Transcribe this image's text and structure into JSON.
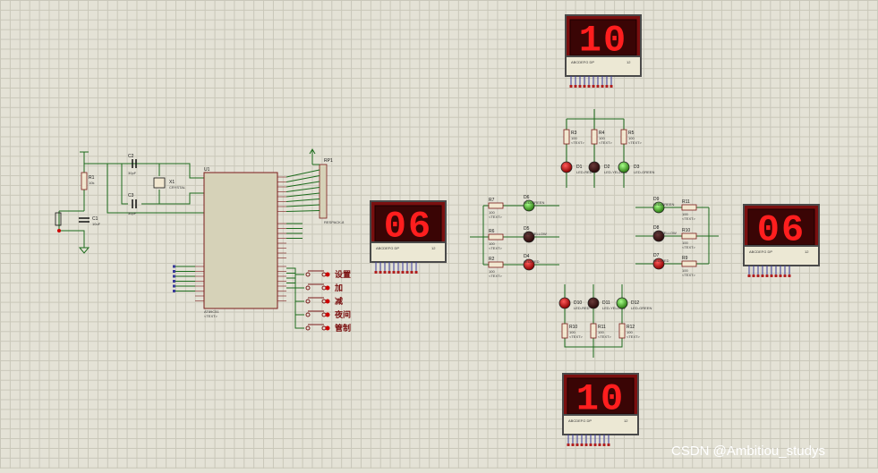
{
  "mcu": {
    "ref": "U1",
    "part": "AT89C51",
    "placeholder": "<TEXT>"
  },
  "crystal": {
    "ref": "X1",
    "part": "CRYSTAL"
  },
  "resistor_pack": {
    "ref": "RP1",
    "part": "RESPACK-8"
  },
  "caps": [
    {
      "ref": "C1",
      "value": "10uF"
    },
    {
      "ref": "C2",
      "value": "30pF"
    },
    {
      "ref": "C3",
      "value": "30pF"
    }
  ],
  "r1": {
    "ref": "R1",
    "value": "10k"
  },
  "displays": {
    "north": {
      "digits": "10",
      "seg_label": "ABCDEFG  DP",
      "pins_label": "12"
    },
    "south": {
      "digits": "10",
      "seg_label": "ABCDEFG  DP",
      "pins_label": "12"
    },
    "west": {
      "digits": "06",
      "seg_label": "ABCDEFG  DP",
      "pins_label": "12"
    },
    "east": {
      "digits": "06",
      "seg_label": "ABCDEFG  DP",
      "pins_label": "12"
    }
  },
  "buttons": [
    "设置",
    "加",
    "减",
    "夜间",
    "管制"
  ],
  "leds": [
    {
      "ref": "D1",
      "type": "LED-RED"
    },
    {
      "ref": "D2",
      "type": "LED-YELLOW"
    },
    {
      "ref": "D3",
      "type": "LED-GREEN"
    },
    {
      "ref": "D4",
      "type": "LED-RED"
    },
    {
      "ref": "D5",
      "type": "LED-YELLOW"
    },
    {
      "ref": "D6",
      "type": "LED-GREEN"
    },
    {
      "ref": "D7",
      "type": "LED-RED"
    },
    {
      "ref": "D8",
      "type": "LED-YELLOW"
    },
    {
      "ref": "D9",
      "type": "LED-GREEN"
    },
    {
      "ref": "D10",
      "type": "LED-RED"
    },
    {
      "ref": "D11",
      "type": "LED-YELLOW"
    },
    {
      "ref": "D12",
      "type": "LED-GREEN"
    }
  ],
  "resistors": [
    {
      "ref": "R2",
      "value": "100"
    },
    {
      "ref": "R3",
      "value": "100"
    },
    {
      "ref": "R4",
      "value": "100"
    },
    {
      "ref": "R5",
      "value": "100"
    },
    {
      "ref": "R6",
      "value": "100"
    },
    {
      "ref": "R7",
      "value": "100"
    },
    {
      "ref": "R8",
      "value": "100"
    },
    {
      "ref": "R9",
      "value": "100"
    },
    {
      "ref": "R10",
      "value": "100"
    },
    {
      "ref": "R11",
      "value": "100"
    },
    {
      "ref": "R12",
      "value": "100"
    },
    {
      "ref": "R13",
      "value": "100"
    }
  ],
  "text_placeholder": "<TEXT>",
  "watermark": "CSDN @Ambitiou_studys",
  "colors": {
    "grid": "#c9c7b9",
    "background": "#e4e2d6",
    "wire": "#1c6b1c",
    "segment_on": "#ff1e1e",
    "display_body": "#7a0f0f"
  }
}
